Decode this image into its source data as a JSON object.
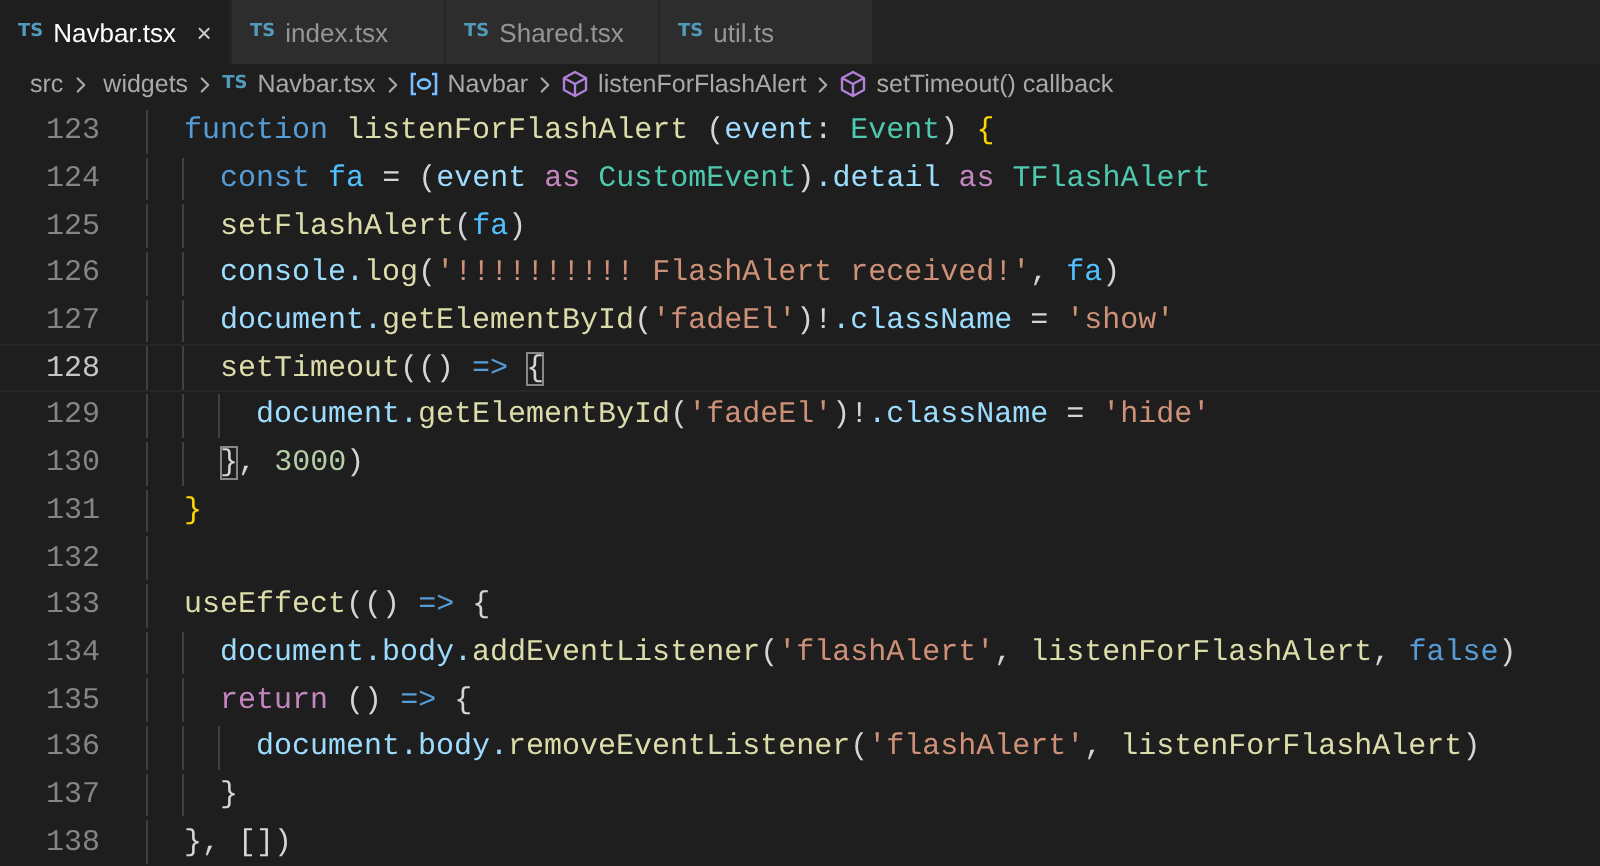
{
  "tabs": [
    {
      "icon_text": "TS",
      "label": "Navbar.tsx",
      "selected": true,
      "close": "×"
    },
    {
      "icon_text": "TS",
      "label": "index.tsx",
      "selected": false
    },
    {
      "icon_text": "TS",
      "label": "Shared.tsx",
      "selected": false
    },
    {
      "icon_text": "TS",
      "label": "util.ts",
      "selected": false
    }
  ],
  "breadcrumbs": [
    {
      "kind": "folder",
      "label": "src"
    },
    {
      "kind": "folder",
      "label": "widgets"
    },
    {
      "kind": "file",
      "icon_text": "TS",
      "label": "Navbar.tsx"
    },
    {
      "kind": "variable",
      "label": "Navbar"
    },
    {
      "kind": "method",
      "label": "listenForFlashAlert"
    },
    {
      "kind": "method",
      "label": "setTimeout() callback"
    }
  ],
  "lines": [
    {
      "number": "123",
      "current": false,
      "tokens": [
        {
          "kind": "keyword",
          "text": "  function"
        },
        {
          "kind": "function",
          "text": " listenForFlashAlert"
        },
        {
          "kind": "punct",
          "text": " ("
        },
        {
          "kind": "variable",
          "text": "event"
        },
        {
          "kind": "punct",
          "text": ":"
        },
        {
          "kind": "type",
          "text": " Event"
        },
        {
          "kind": "punct",
          "text": ")"
        },
        {
          "kind": "bracket",
          "text": " {"
        }
      ]
    },
    {
      "number": "124",
      "current": false,
      "tokens": [
        {
          "kind": "keyword",
          "text": "    const"
        },
        {
          "kind": "constant",
          "text": " fa"
        },
        {
          "kind": "punct",
          "text": " = ("
        },
        {
          "kind": "variable",
          "text": "event"
        },
        {
          "kind": "control",
          "text": " as"
        },
        {
          "kind": "type",
          "text": " CustomEvent"
        },
        {
          "kind": "punct",
          "text": ")"
        },
        {
          "kind": "variable",
          "text": ".detail"
        },
        {
          "kind": "control",
          "text": " as"
        },
        {
          "kind": "type",
          "text": " TFlashAlert"
        }
      ]
    },
    {
      "number": "125",
      "current": false,
      "tokens": [
        {
          "kind": "function",
          "text": "    setFlashAlert"
        },
        {
          "kind": "punct",
          "text": "("
        },
        {
          "kind": "constant",
          "text": "fa"
        },
        {
          "kind": "punct",
          "text": ")"
        }
      ]
    },
    {
      "number": "126",
      "current": false,
      "tokens": [
        {
          "kind": "variable",
          "text": "    console."
        },
        {
          "kind": "function",
          "text": "log"
        },
        {
          "kind": "punct",
          "text": "("
        },
        {
          "kind": "string",
          "text": "'!!!!!!!!!! FlashAlert received!'"
        },
        {
          "kind": "punct",
          "text": ","
        },
        {
          "kind": "constant",
          "text": " fa"
        },
        {
          "kind": "punct",
          "text": ")"
        }
      ]
    },
    {
      "number": "127",
      "current": false,
      "tokens": [
        {
          "kind": "variable",
          "text": "    document."
        },
        {
          "kind": "function",
          "text": "getElementById"
        },
        {
          "kind": "punct",
          "text": "("
        },
        {
          "kind": "string",
          "text": "'fadeEl'"
        },
        {
          "kind": "punct",
          "text": ")!"
        },
        {
          "kind": "variable",
          "text": ".className"
        },
        {
          "kind": "punct",
          "text": " ="
        },
        {
          "kind": "string",
          "text": " 'show'"
        }
      ]
    },
    {
      "number": "128",
      "current": true,
      "tokens": [
        {
          "kind": "function",
          "text": "    setTimeout"
        },
        {
          "kind": "punct",
          "text": "(() "
        },
        {
          "kind": "keyword",
          "text": "=> "
        },
        {
          "kind": "match",
          "text": "{"
        }
      ]
    },
    {
      "number": "129",
      "current": false,
      "tokens": [
        {
          "kind": "variable",
          "text": "      document."
        },
        {
          "kind": "function",
          "text": "getElementById"
        },
        {
          "kind": "punct",
          "text": "("
        },
        {
          "kind": "string",
          "text": "'fadeEl'"
        },
        {
          "kind": "punct",
          "text": ")!"
        },
        {
          "kind": "variable",
          "text": ".className"
        },
        {
          "kind": "punct",
          "text": " ="
        },
        {
          "kind": "string",
          "text": " 'hide'"
        }
      ]
    },
    {
      "number": "130",
      "current": false,
      "tokens": [
        {
          "kind": "match",
          "text": "    }"
        },
        {
          "kind": "punct",
          "text": ","
        },
        {
          "kind": "number",
          "text": " 3000"
        },
        {
          "kind": "punct",
          "text": ")"
        }
      ]
    },
    {
      "number": "131",
      "current": false,
      "tokens": [
        {
          "kind": "bracket",
          "text": "  }"
        }
      ]
    },
    {
      "number": "132",
      "current": false
    },
    {
      "number": "133",
      "current": false,
      "tokens": [
        {
          "kind": "function",
          "text": "  useEffect"
        },
        {
          "kind": "punct",
          "text": "(()"
        },
        {
          "kind": "keyword",
          "text": " =>"
        },
        {
          "kind": "punct",
          "text": " {"
        }
      ]
    },
    {
      "number": "134",
      "current": false,
      "tokens": [
        {
          "kind": "variable",
          "text": "    document.body."
        },
        {
          "kind": "function",
          "text": "addEventListener"
        },
        {
          "kind": "punct",
          "text": "("
        },
        {
          "kind": "string",
          "text": "'flashAlert'"
        },
        {
          "kind": "punct",
          "text": ","
        },
        {
          "kind": "function",
          "text": " listenForFlashAlert"
        },
        {
          "kind": "punct",
          "text": ","
        },
        {
          "kind": "keyword",
          "text": " false"
        },
        {
          "kind": "punct",
          "text": ")"
        }
      ]
    },
    {
      "number": "135",
      "current": false,
      "tokens": [
        {
          "kind": "control",
          "text": "    return"
        },
        {
          "kind": "punct",
          "text": " ()"
        },
        {
          "kind": "keyword",
          "text": " =>"
        },
        {
          "kind": "punct",
          "text": " {"
        }
      ]
    },
    {
      "number": "136",
      "current": false,
      "tokens": [
        {
          "kind": "variable",
          "text": "      document.body."
        },
        {
          "kind": "function",
          "text": "removeEventListener"
        },
        {
          "kind": "punct",
          "text": "("
        },
        {
          "kind": "string",
          "text": "'flashAlert'"
        },
        {
          "kind": "punct",
          "text": ","
        },
        {
          "kind": "function",
          "text": " listenForFlashAlert"
        },
        {
          "kind": "punct",
          "text": ")"
        }
      ]
    },
    {
      "number": "137",
      "current": false,
      "tokens": [
        {
          "kind": "punct",
          "text": "    }"
        }
      ]
    },
    {
      "number": "138",
      "current": false,
      "tokens": [
        {
          "kind": "punct",
          "text": "  }, [])"
        }
      ]
    }
  ]
}
